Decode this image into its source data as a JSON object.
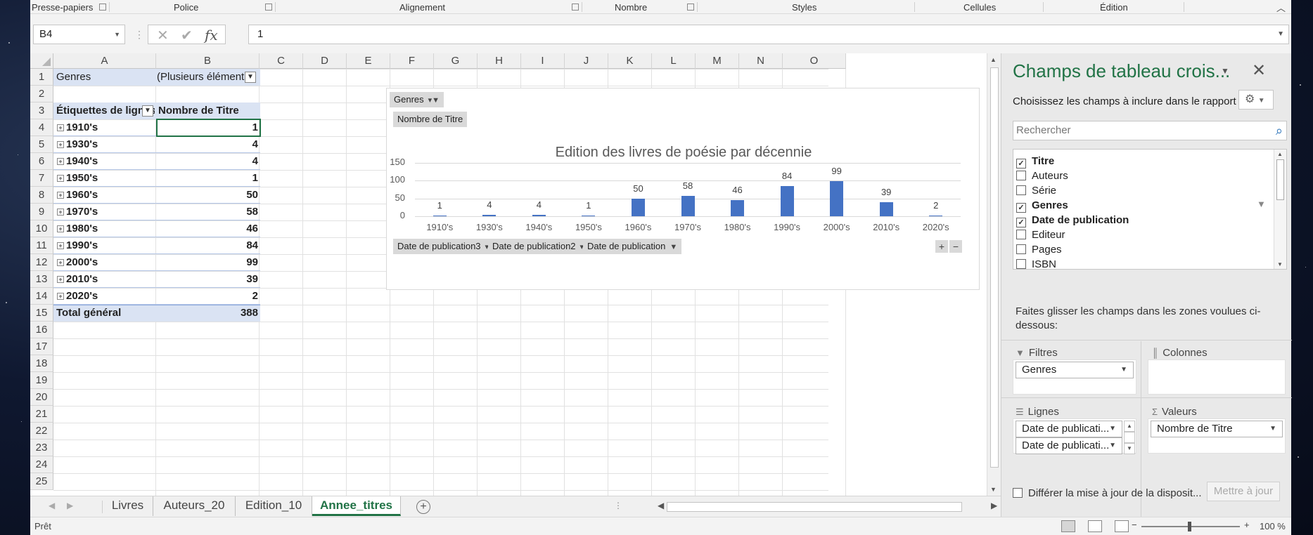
{
  "ribbon": {
    "groups": [
      "Presse-papiers",
      "Police",
      "Alignement",
      "Nombre",
      "Styles",
      "Cellules",
      "Édition"
    ]
  },
  "formula_bar": {
    "name_box": "B4",
    "cancel_icon": "✕",
    "enter_icon": "✔",
    "fx_label": "fx",
    "value": "1"
  },
  "grid": {
    "columns": [
      "A",
      "B",
      "C",
      "D",
      "E",
      "F",
      "G",
      "H",
      "I",
      "J",
      "K",
      "L",
      "M",
      "N",
      "O"
    ],
    "rows": [
      "1",
      "2",
      "3",
      "4",
      "5",
      "6",
      "7",
      "8",
      "9",
      "10",
      "11",
      "12",
      "13",
      "14",
      "15",
      "16",
      "17",
      "18",
      "19",
      "20",
      "21",
      "22",
      "23",
      "24",
      "25"
    ]
  },
  "pivot": {
    "filter_label": "Genres",
    "filter_value": "(Plusieurs éléments)",
    "row_header": "Étiquettes de lignes",
    "value_header": "Nombre de Titre",
    "rows": [
      {
        "label": "1910's",
        "value": "1"
      },
      {
        "label": "1930's",
        "value": "4"
      },
      {
        "label": "1940's",
        "value": "4"
      },
      {
        "label": "1950's",
        "value": "1"
      },
      {
        "label": "1960's",
        "value": "50"
      },
      {
        "label": "1970's",
        "value": "58"
      },
      {
        "label": "1980's",
        "value": "46"
      },
      {
        "label": "1990's",
        "value": "84"
      },
      {
        "label": "2000's",
        "value": "99"
      },
      {
        "label": "2010's",
        "value": "39"
      },
      {
        "label": "2020's",
        "value": "2"
      }
    ],
    "total_label": "Total général",
    "total_value": "388"
  },
  "chart_buttons": {
    "genres": "Genres",
    "values": "Nombre de Titre",
    "axis1": "Date de publication3",
    "axis2": "Date de publication2",
    "axis3": "Date de publication"
  },
  "chart_data": {
    "type": "bar",
    "title": "Edition des livres de poésie par décennie",
    "categories": [
      "1910's",
      "1930's",
      "1940's",
      "1950's",
      "1960's",
      "1970's",
      "1980's",
      "1990's",
      "2000's",
      "2010's",
      "2020's"
    ],
    "values": [
      1,
      4,
      4,
      1,
      50,
      58,
      46,
      84,
      99,
      39,
      2
    ],
    "yticks": [
      "0",
      "50",
      "100",
      "150"
    ],
    "ylim": [
      0,
      150
    ],
    "grid": true,
    "legend": "none",
    "color": "#4472c4"
  },
  "sheets": {
    "tabs": [
      "Livres",
      "Auteurs_20",
      "Edition_10",
      "Annee_titres"
    ],
    "active": "Annee_titres"
  },
  "status": {
    "text": "Prêt",
    "zoom": "100 %"
  },
  "pane": {
    "title": "Champs de tableau crois...",
    "subtitle": "Choisissez les champs à inclure dans le rapport :",
    "search_placeholder": "Rechercher",
    "fields": [
      {
        "label": "Titre",
        "checked": true
      },
      {
        "label": "Auteurs",
        "checked": false
      },
      {
        "label": "Série",
        "checked": false
      },
      {
        "label": "Genres",
        "checked": true
      },
      {
        "label": "Date de publication",
        "checked": true
      },
      {
        "label": "Editeur",
        "checked": false
      },
      {
        "label": "Pages",
        "checked": false
      },
      {
        "label": "ISBN",
        "checked": false
      }
    ],
    "drag_hint": "Faites glisser les champs dans les zones voulues ci-dessous:",
    "areas": {
      "filters_label": "Filtres",
      "columns_label": "Colonnes",
      "rows_label": "Lignes",
      "values_label": "Valeurs",
      "filters_chip": "Genres",
      "rows_chip1": "Date de publicati...",
      "rows_chip2": "Date de publicati...",
      "values_chip": "Nombre de Titre"
    },
    "defer_label": "Différer la mise à jour de la disposit...",
    "update_button": "Mettre à jour"
  }
}
